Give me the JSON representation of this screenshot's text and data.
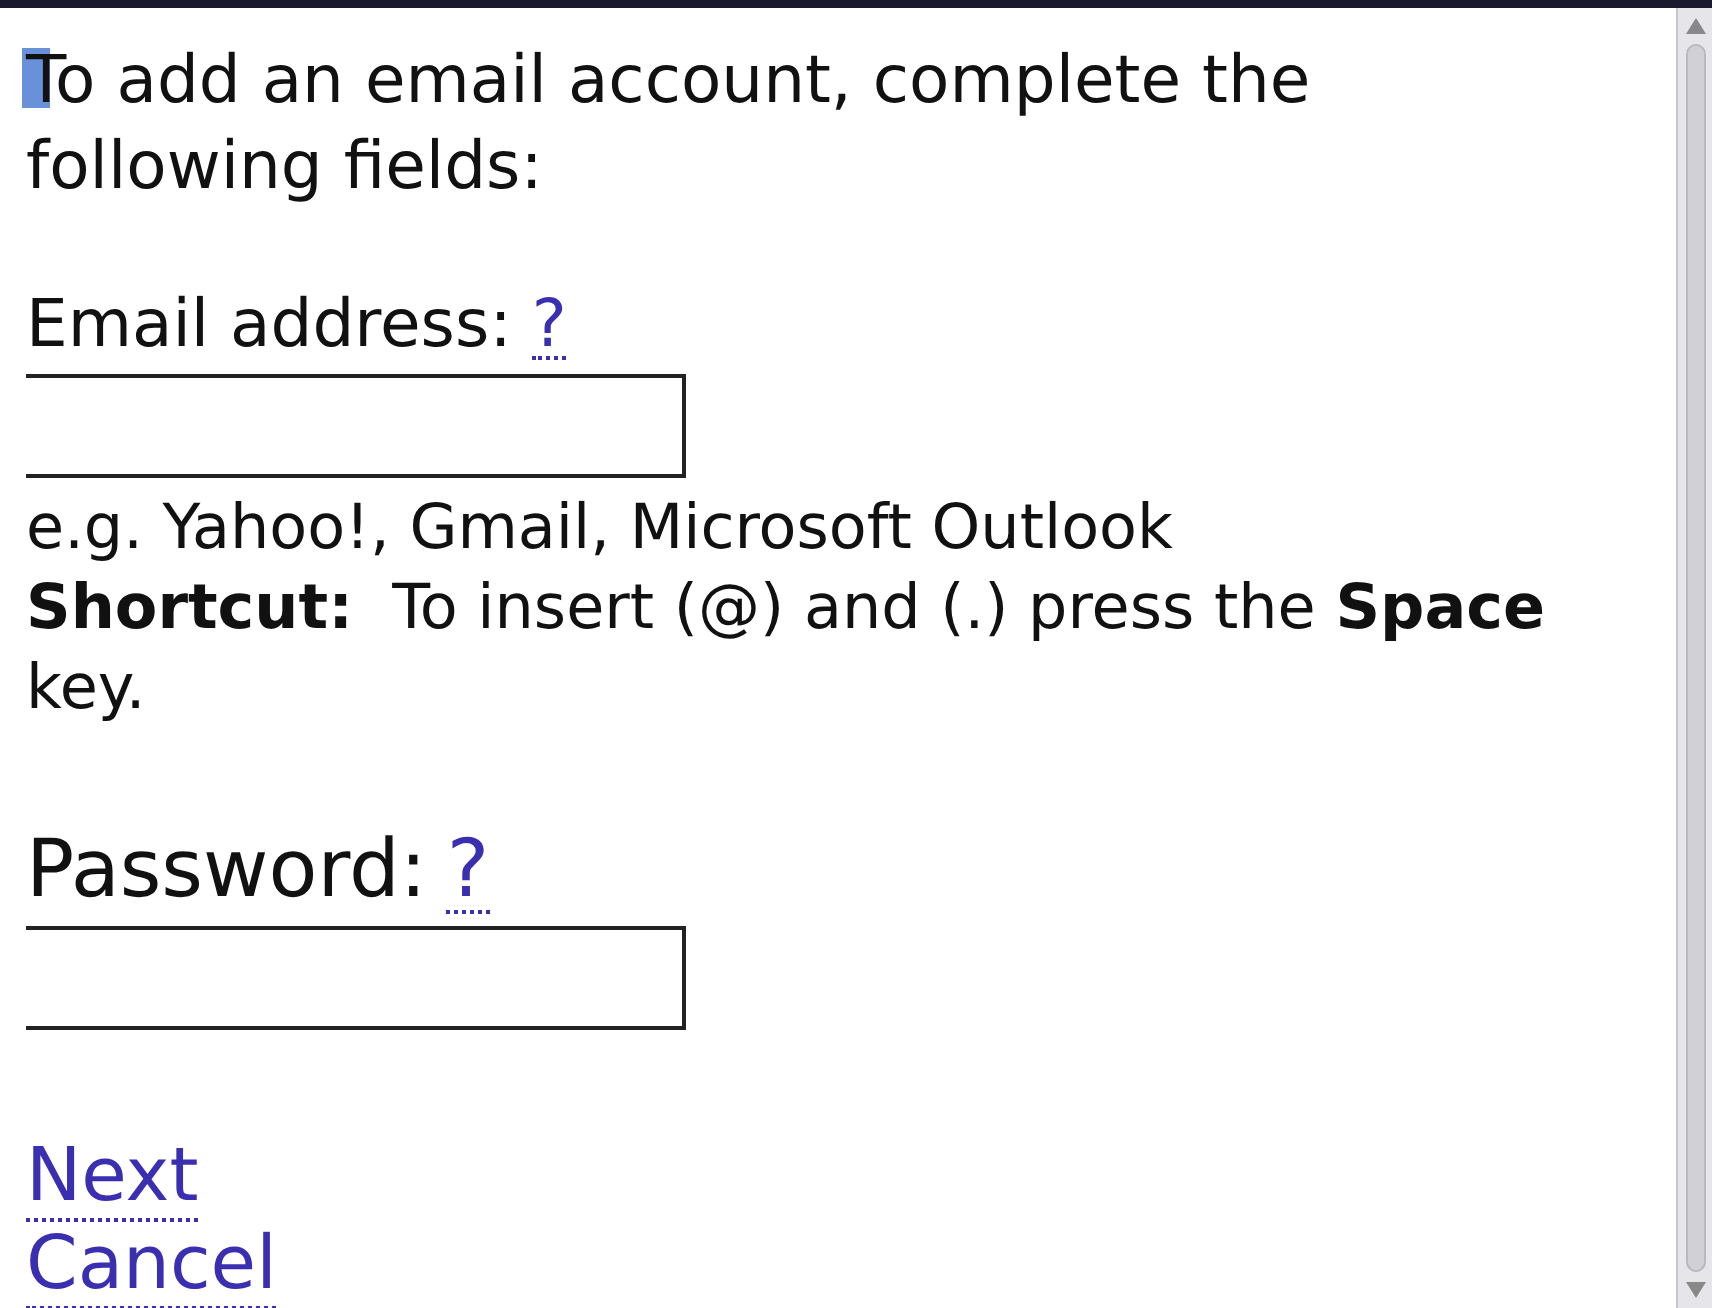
{
  "intro": {
    "text": "To add an email account, complete the following fields:",
    "cursor": true
  },
  "fields": [
    {
      "label": "Email address:",
      "help": "?",
      "kind": "small"
    },
    {
      "label": "Password:",
      "help": "?",
      "kind": "large"
    }
  ],
  "hint": "e.g. Yahoo!, Gmail, Microsoft Outlook",
  "shortcut": "**Shortcut:**  To insert (@) and (.) press the **Space** key.",
  "links": [
    "Next",
    "Cancel"
  ]
}
